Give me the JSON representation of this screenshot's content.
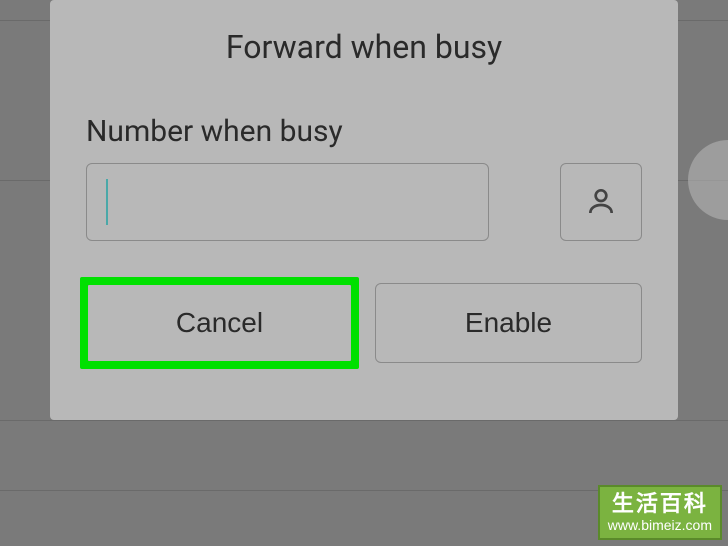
{
  "dialog": {
    "title": "Forward when busy",
    "field_label": "Number when busy",
    "input_value": "",
    "input_placeholder": "",
    "contact_icon": "person-icon",
    "buttons": {
      "cancel": "Cancel",
      "enable": "Enable"
    },
    "highlighted_button": "cancel"
  },
  "watermark": {
    "title": "生活百科",
    "url": "www.bimeiz.com"
  }
}
